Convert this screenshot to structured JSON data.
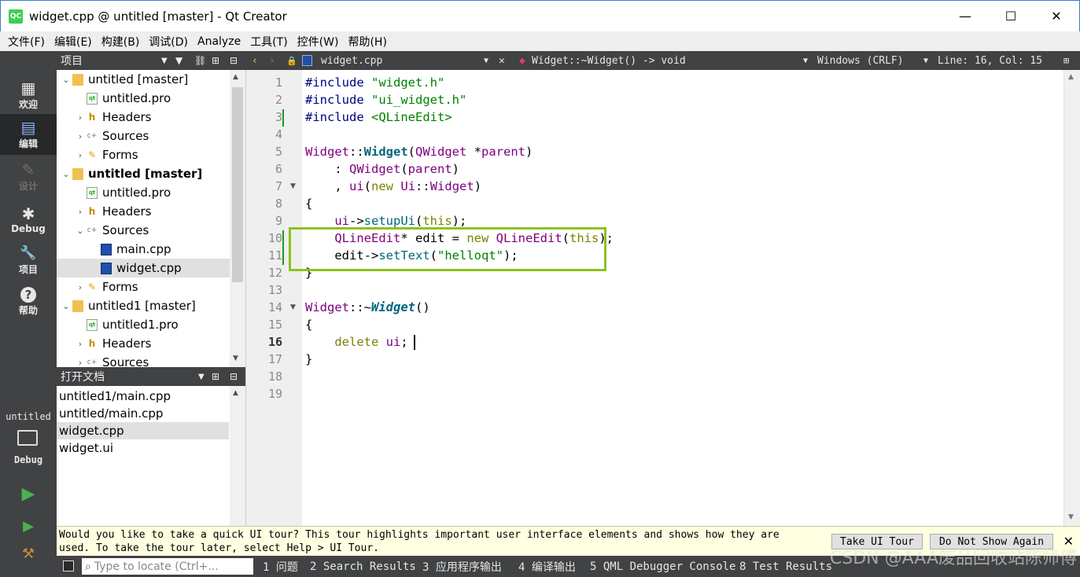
{
  "window": {
    "logo_text": "QC",
    "title": "widget.cpp @ untitled [master] - Qt Creator",
    "minimize": "—",
    "maximize": "☐",
    "close": "✕"
  },
  "menubar": [
    "文件(F)",
    "编辑(E)",
    "构建(B)",
    "调试(D)",
    "Analyze",
    "工具(T)",
    "控件(W)",
    "帮助(H)"
  ],
  "modes": [
    {
      "label": "欢迎",
      "icon": "▦"
    },
    {
      "label": "编辑",
      "icon": "▤"
    },
    {
      "label": "设计",
      "icon": "✎"
    },
    {
      "label": "Debug",
      "icon": "✱"
    },
    {
      "label": "项目",
      "icon": "🔧"
    },
    {
      "label": "帮助",
      "icon": "?"
    }
  ],
  "kit": {
    "project": "untitled",
    "mode": "Debug"
  },
  "project_pane": {
    "title": "项目",
    "tree": [
      {
        "label": "untitled [master]",
        "type": "project",
        "expand": "⌄",
        "bold": false
      },
      {
        "label": "untitled.pro",
        "type": "pro",
        "expand": "",
        "bold": false
      },
      {
        "label": "Headers",
        "type": "h",
        "expand": "›",
        "bold": false
      },
      {
        "label": "Sources",
        "type": "cpp",
        "expand": "›",
        "bold": false
      },
      {
        "label": "Forms",
        "type": "forms",
        "expand": "›",
        "bold": false
      },
      {
        "label": "untitled [master]",
        "type": "project",
        "expand": "⌄",
        "bold": true
      },
      {
        "label": "untitled.pro",
        "type": "pro",
        "expand": "",
        "bold": false
      },
      {
        "label": "Headers",
        "type": "h",
        "expand": "›",
        "bold": false
      },
      {
        "label": "Sources",
        "type": "cpp",
        "expand": "⌄",
        "bold": false
      },
      {
        "label": "main.cpp",
        "type": "cppfile",
        "expand": "",
        "bold": false
      },
      {
        "label": "widget.cpp",
        "type": "cppfile",
        "expand": "",
        "bold": false,
        "selected": true
      },
      {
        "label": "Forms",
        "type": "forms",
        "expand": "›",
        "bold": false
      },
      {
        "label": "untitled1 [master]",
        "type": "project",
        "expand": "⌄",
        "bold": false
      },
      {
        "label": "untitled1.pro",
        "type": "pro",
        "expand": "",
        "bold": false
      },
      {
        "label": "Headers",
        "type": "h",
        "expand": "›",
        "bold": false
      },
      {
        "label": "Sources",
        "type": "cpp",
        "expand": "›",
        "bold": false
      }
    ]
  },
  "open_docs": {
    "title": "打开文档",
    "items": [
      "untitled1/main.cpp",
      "untitled/main.cpp",
      "widget.cpp",
      "widget.ui"
    ],
    "selected_index": 2
  },
  "editor_toolbar": {
    "file": "widget.cpp",
    "symbol": "Widget::~Widget() -> void",
    "line_ending": "Windows (CRLF)",
    "position": "Line: 16, Col: 15"
  },
  "code": {
    "line_numbers": [
      "1",
      "2",
      "3",
      "4",
      "5",
      "6",
      "7",
      "8",
      "9",
      "10",
      "11",
      "12",
      "13",
      "14",
      "15",
      "16",
      "17",
      "18",
      "19"
    ],
    "current_line": 16
  },
  "infobar": {
    "text": "Would you like to take a quick UI tour? This tour highlights important user interface elements and shows how they are used. To take the tour later, select Help > UI Tour.",
    "take_tour": "Take UI Tour",
    "dont_show": "Do Not Show Again",
    "close": "✕"
  },
  "statusbar": {
    "locator_placeholder": "Type to locate (Ctrl+...",
    "panes": [
      "1 问题",
      "2 Search Results",
      "3 应用程序输出",
      "4 编译输出",
      "5 QML Debugger Console",
      "8 Test Results"
    ]
  },
  "watermark": "CSDN @AAA废品回收站陈师傅"
}
